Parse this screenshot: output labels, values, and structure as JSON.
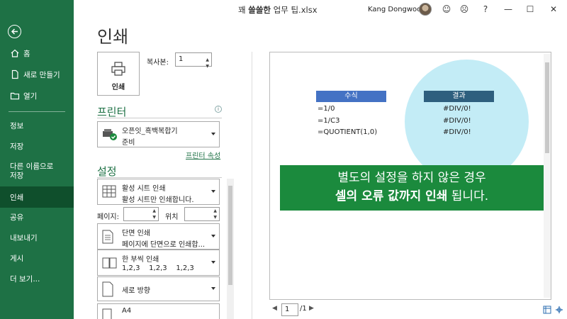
{
  "title_bar": {
    "doc_prefix": "꽤 ",
    "doc_bold": "쓸쓸한",
    "doc_suffix": " 업무 팁.xlsx",
    "user_name": "Kang Dongwoo",
    "icons": [
      "smile-icon",
      "frown-icon",
      "help-icon",
      "minimize-icon",
      "maximize-icon",
      "close-icon"
    ],
    "glyphs": {
      "smile": "☺",
      "frown": "☹",
      "help": "?",
      "minimize": "—",
      "maximize": "☐",
      "close": "✕"
    }
  },
  "sidebar": {
    "items": [
      {
        "label": "홈",
        "icon": "home-icon"
      },
      {
        "label": "새로 만들기",
        "icon": "new-file-icon"
      },
      {
        "label": "열기",
        "icon": "open-folder-icon"
      },
      {
        "label": "정보"
      },
      {
        "label": "저장"
      },
      {
        "label": "다른 이름으로\n저장"
      },
      {
        "label": "인쇄",
        "active": true
      },
      {
        "label": "공유"
      },
      {
        "label": "내보내기"
      },
      {
        "label": "게시"
      },
      {
        "label": "더 보기..."
      }
    ]
  },
  "main": {
    "title": "인쇄",
    "print_button_label": "인쇄",
    "copies_label": "복사본:",
    "copies_value": "1",
    "printer_section": "프린터",
    "printer_name": "오픈잇_흑백복합기",
    "printer_status": "준비",
    "printer_properties": "프린터 속성",
    "settings_section": "설정",
    "print_what": {
      "title": "활성 시트 인쇄",
      "desc": "활성 시트만 인쇄합니다."
    },
    "pages_label": "페이지:",
    "to_label": "위치",
    "sides": {
      "title": "단면 인쇄",
      "desc": "페이지에 단면으로 인쇄합..."
    },
    "collate": {
      "title": "한 부씩 인쇄",
      "desc": "1,2,3    1,2,3    1,2,3"
    },
    "orientation": {
      "title": "세로 방향"
    },
    "paper": {
      "title": "A4"
    }
  },
  "preview": {
    "header_formula": "수식",
    "header_result": "결과",
    "header_formula_color": "#4472c4",
    "header_result_color": "#2e5f7e",
    "rows": [
      {
        "formula": "=1/0",
        "result": "#DIV/0!"
      },
      {
        "formula": "=1/C3",
        "result": "#DIV/0!"
      },
      {
        "formula": "=QUOTIENT(1,0)",
        "result": "#DIV/0!"
      }
    ],
    "callout_line1": "별도의 설정을 하지 않은 경우",
    "callout_line2_bold": "셀의 오류 값까지 인쇄",
    "callout_line2_rest": " 됩니다.",
    "page_current": "1",
    "page_total": "/1"
  },
  "colors": {
    "sidebar": "#1e7145",
    "sidebar_active": "#0f4f2c",
    "callout": "#1b8a3d",
    "bubble": "#c3ecf6"
  }
}
